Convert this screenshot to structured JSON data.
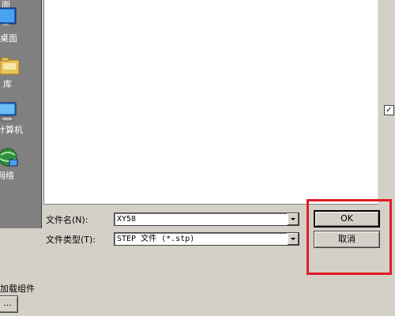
{
  "places": [
    {
      "label": "桌面",
      "icon": "desktop-icon"
    },
    {
      "label": "库",
      "icon": "library-icon"
    },
    {
      "label": "计算机",
      "icon": "computer-icon"
    },
    {
      "label": "网络",
      "icon": "network-icon"
    }
  ],
  "top_partial_label": "面",
  "checkbox_mark": "✓",
  "file_name": {
    "label": "文件名(N):",
    "value": "XY58"
  },
  "file_type": {
    "label": "文件类型(T):",
    "value": "STEP 文件 (*.stp)"
  },
  "buttons": {
    "ok": "OK",
    "cancel": "取消"
  },
  "addin": {
    "label": "加载组件",
    "button": "..."
  },
  "colors": {
    "highlight": "#e01c24",
    "dialog_bg": "#d4d0c8",
    "places_bg": "#808080"
  }
}
